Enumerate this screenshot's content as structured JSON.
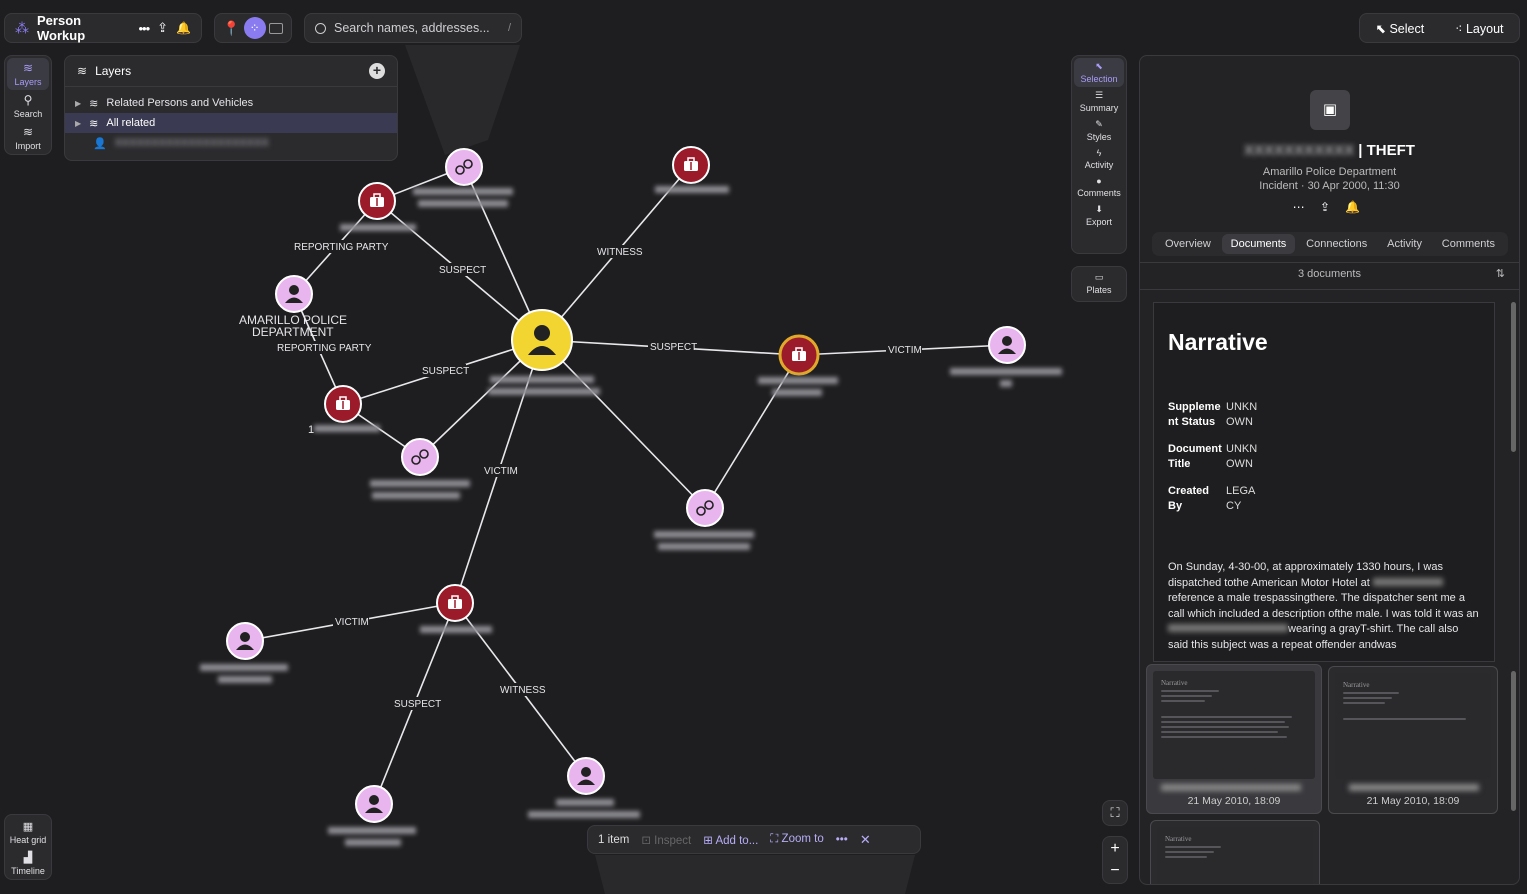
{
  "app": {
    "title": "Person Workup",
    "search_placeholder": "Search names, addresses...",
    "search_shortcut": "/",
    "select_label": "Select",
    "layout_label": "Layout"
  },
  "left_rail": {
    "layers": "Layers",
    "search": "Search",
    "import": "Import",
    "heat_grid": "Heat grid",
    "timeline": "Timeline"
  },
  "layers_panel": {
    "title": "Layers",
    "items": [
      "Related Persons and Vehicles",
      "All related"
    ],
    "sub_item_redacted": "XXXXXXXXXXXXXXXXXXXXX"
  },
  "right_rail": {
    "selection": "Selection",
    "summary": "Summary",
    "styles": "Styles",
    "activity": "Activity",
    "comments": "Comments",
    "export": "Export",
    "plates": "Plates"
  },
  "graph": {
    "edge_labels": {
      "reporting_party_1": "REPORTING PARTY",
      "suspect_top": "SUSPECT",
      "witness_top": "WITNESS",
      "reporting_party_2": "REPORTING PARTY",
      "suspect_mid": "SUSPECT",
      "suspect_right": "SUSPECT",
      "victim_right": "VICTIM",
      "victim_center": "VICTIM",
      "victim_bottom": "VICTIM",
      "suspect_bottom": "SUSPECT",
      "witness_bottom": "WITNESS"
    },
    "node_labels": {
      "amarillo_pd_line1": "AMARILLO POLICE",
      "amarillo_pd_line2": "DEPARTMENT",
      "case_prefix": "1"
    }
  },
  "detail": {
    "title_redacted": "XXXXXXXXXXX",
    "title": "THEFT",
    "org": "Amarillo Police Department",
    "meta": "Incident · 30 Apr 2000, 11:30",
    "tabs": [
      "Overview",
      "Documents",
      "Connections",
      "Activity",
      "Comments"
    ],
    "active_tab": "Documents",
    "doc_count": "3 documents",
    "doc": {
      "heading": "Narrative",
      "fields": [
        {
          "k": "Suppleme nt Status",
          "v": "UNKN OWN"
        },
        {
          "k": "Document Title",
          "v": "UNKN OWN"
        },
        {
          "k": "Created By",
          "v": "LEGA CY"
        }
      ],
      "body_1": "On Sunday, 4-30-00, at approximately 1330 hours, I was dispatched tothe American Motor Hotel at",
      "body_2": "reference a male trespassingthere.  The dispatcher sent me a call which included a description ofthe male.  I was told it was an",
      "body_3": "wearing a grayT-shirt.  The call also said this subject was a repeat offender andwas"
    },
    "thumbs": [
      {
        "title": "Narrative",
        "date": "21 May 2010, 18:09"
      },
      {
        "title": "Narrative",
        "date": "21 May 2010, 18:09"
      },
      {
        "title": "Narrative",
        "date": ""
      }
    ]
  },
  "bottom_bar": {
    "count": "1 item",
    "inspect": "Inspect",
    "add_to": "Add to...",
    "zoom_to": "Zoom to"
  },
  "colors": {
    "bg": "#1e1e20",
    "incident": "#9b1b2a",
    "person": "#e9b5ee",
    "focus": "#f2d530",
    "accent": "#8a7cf0"
  }
}
